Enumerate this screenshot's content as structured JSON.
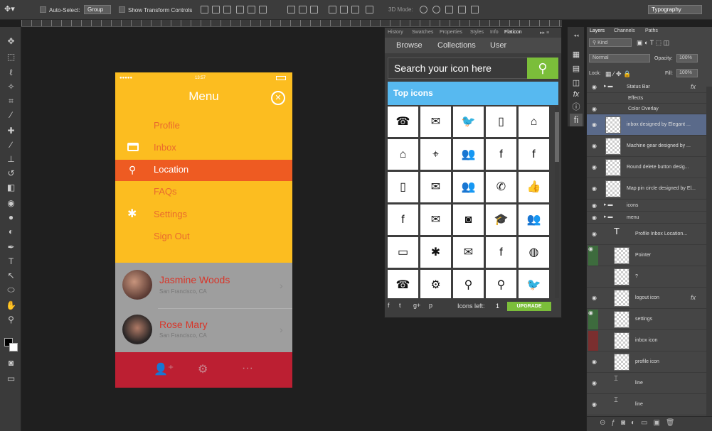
{
  "options_bar": {
    "auto_select_label": "Auto-Select:",
    "auto_select_value": "Group",
    "show_transform_label": "Show Transform Controls",
    "mode_3d_label": "3D Mode:",
    "workspace": "Typography"
  },
  "toolbar": {
    "tools": [
      "move-tool",
      "marquee-tool",
      "lasso-tool",
      "magic-wand-tool",
      "crop-tool",
      "eyedropper-tool",
      "healing-brush-tool",
      "brush-tool",
      "clone-stamp-tool",
      "history-brush-tool",
      "eraser-tool",
      "paint-bucket-tool",
      "blur-tool",
      "dodge-tool",
      "pen-tool",
      "type-tool",
      "path-selection-tool",
      "ellipse-tool",
      "hand-tool",
      "zoom-tool"
    ]
  },
  "phone": {
    "status_time": "13:57",
    "title": "Menu",
    "menu": [
      {
        "label": "Profile",
        "icon": ""
      },
      {
        "label": "Inbox",
        "icon": "inbox-icon"
      },
      {
        "label": "Location",
        "icon": "map-pin-icon",
        "active": true
      },
      {
        "label": "FAQs",
        "icon": ""
      },
      {
        "label": "Settings",
        "icon": "gear-icon"
      },
      {
        "label": "Sign Out",
        "icon": ""
      }
    ],
    "contacts": [
      {
        "name": "Jasmine Woods",
        "location": "San Francisco, CA"
      },
      {
        "name": "Rose Mary",
        "location": "San Francisco, CA"
      }
    ],
    "bottom_icons": [
      "add-user-icon",
      "settings-icon",
      "more-icon"
    ]
  },
  "flaticon": {
    "tabs": [
      "History",
      "Swatches",
      "Properties",
      "Styles",
      "Info",
      "Flaticon"
    ],
    "nav": [
      "Browse",
      "Collections",
      "User"
    ],
    "search_placeholder": "Search your icon here",
    "section": "Top icons",
    "icons_left_label": "Icons left:",
    "icons_left": "1",
    "upgrade": "UPGRADE",
    "social": [
      "f",
      "t",
      "g+",
      "p"
    ],
    "icons": [
      [
        "☎",
        "✉",
        "🐦",
        "▯",
        "⌂"
      ],
      [
        "⌂",
        "⌖",
        "👥",
        "f",
        "f"
      ],
      [
        "▯",
        "✉",
        "👥",
        "✆",
        "👍"
      ],
      [
        "f",
        "✉",
        "◙",
        "🎓",
        "👥"
      ],
      [
        "▭",
        "✱",
        "✉",
        "f",
        "◍"
      ],
      [
        "☎",
        "⚙",
        "⚲",
        "⚲",
        "🐦"
      ]
    ]
  },
  "layers": {
    "tabs": [
      "Layers",
      "Channels",
      "Paths"
    ],
    "kind": "Kind",
    "blend": "Normal",
    "opacity_label": "Opacity:",
    "opacity": "100%",
    "lock_label": "Lock:",
    "fill_label": "Fill:",
    "fill": "100%",
    "items": [
      {
        "name": "Status Bar",
        "type": "group",
        "fx": true
      },
      {
        "name": "Effects",
        "type": "effect"
      },
      {
        "name": "Color Overlay",
        "type": "effect"
      },
      {
        "name": "inbox designed by Elegant ...",
        "type": "smart"
      },
      {
        "name": "Machine gear designed by ...",
        "type": "smart"
      },
      {
        "name": "Round delete button desig...",
        "type": "smart"
      },
      {
        "name": "Map pin circle designed by El...",
        "type": "smart"
      },
      {
        "name": "icons",
        "type": "group"
      },
      {
        "name": "menu",
        "type": "group"
      },
      {
        "name": "Profile  Inbox  Location...",
        "type": "text"
      },
      {
        "name": "Pointer",
        "type": "smart"
      },
      {
        "name": "?",
        "type": "smart"
      },
      {
        "name": "logout icon",
        "type": "smart",
        "fx": true
      },
      {
        "name": "settings",
        "type": "smart"
      },
      {
        "name": "inbox icon",
        "type": "smart"
      },
      {
        "name": "profile icon",
        "type": "smart"
      },
      {
        "name": "line",
        "type": "shape"
      },
      {
        "name": "line",
        "type": "shape"
      }
    ]
  },
  "colors": {
    "phone_bg": "#fcbd20",
    "active_row": "#ee5b22",
    "menu_text": "#e96a2e",
    "contact_name": "#d8362a",
    "bottom_bar": "#bc1f32",
    "flaticon_green": "#7bbe3a",
    "flaticon_blue": "#57b9f0"
  }
}
